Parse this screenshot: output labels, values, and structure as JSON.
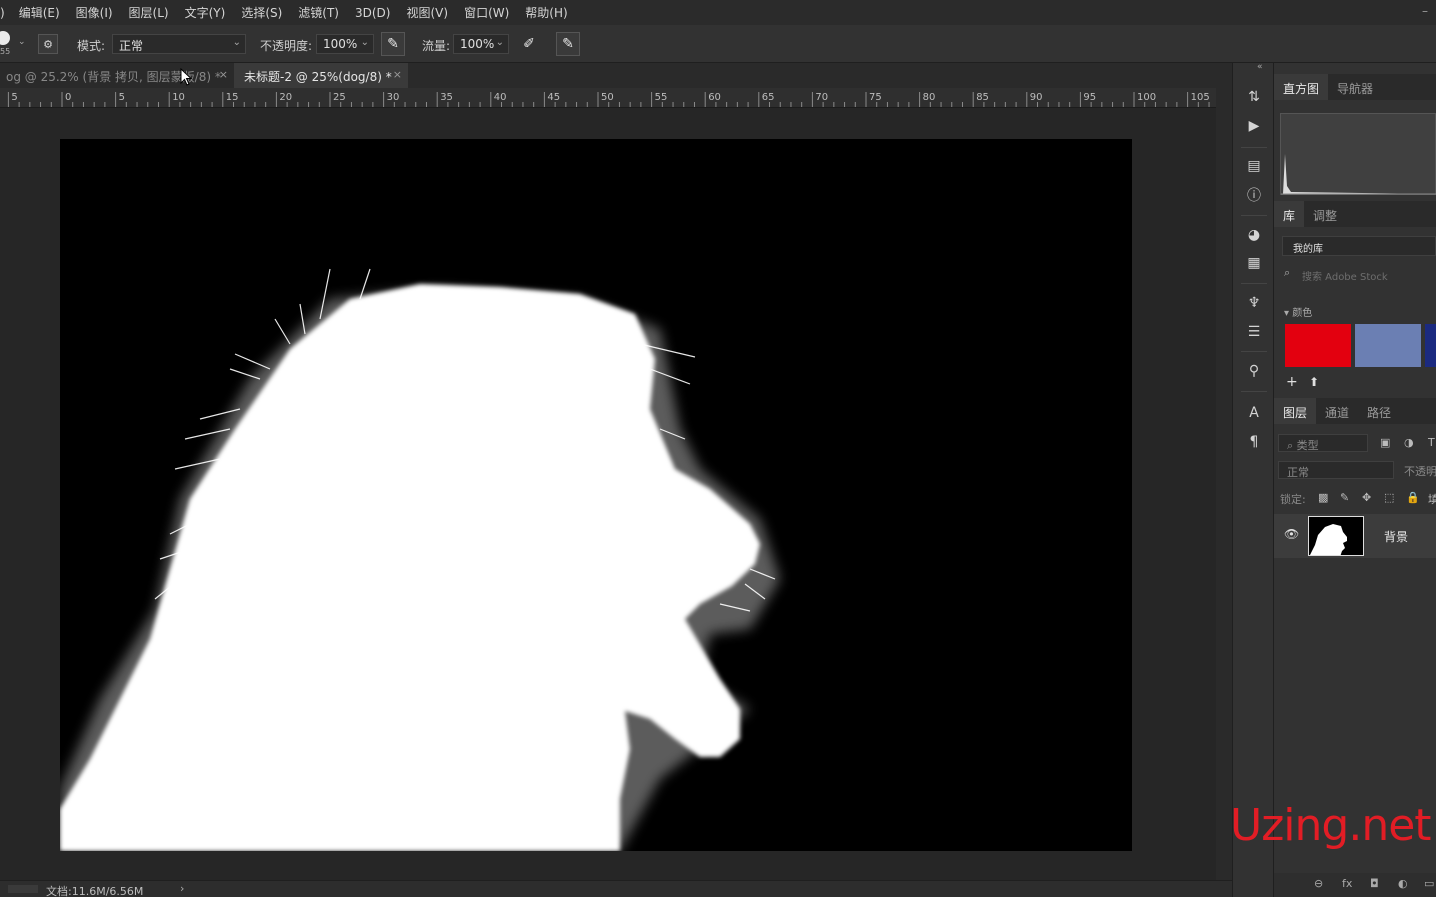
{
  "menu": {
    "partial_first": ")",
    "items": [
      "编辑(E)",
      "图像(I)",
      "图层(L)",
      "文字(Y)",
      "选择(S)",
      "滤镜(T)",
      "3D(D)",
      "视图(V)",
      "窗口(W)",
      "帮助(H)"
    ],
    "minimize": "–"
  },
  "options": {
    "brush_size": "55",
    "mode_label": "模式:",
    "mode_value": "正常",
    "opacity_label": "不透明度:",
    "opacity_value": "100%",
    "flow_label": "流量:",
    "flow_value": "100%"
  },
  "tabs": [
    {
      "label": "og @ 25.2% (背景 拷贝, 图层蒙版/8) *",
      "close": "×",
      "active": false
    },
    {
      "label": "未标题-2 @ 25%(dog/8) *",
      "close": "×",
      "active": true
    }
  ],
  "ruler": {
    "labels": [
      "5",
      "0",
      "5",
      "10",
      "15",
      "20",
      "25",
      "30",
      "35",
      "40",
      "45",
      "50",
      "55",
      "60",
      "65",
      "70",
      "75",
      "80",
      "85",
      "90",
      "95",
      "100",
      "105"
    ]
  },
  "status": {
    "doc_info": "文档:11.6M/6.56M",
    "arrow": "›"
  },
  "panels": {
    "histogram_tabs": [
      "直方图",
      "导航器"
    ],
    "library_tabs": [
      "库",
      "调整"
    ],
    "library_name": "我的库",
    "search_placeholder": "搜索 Adobe Stock",
    "colors_header": "▾ 颜色",
    "swatch_colors": [
      "#e3000f",
      "#6b7fb3",
      "#1b2a80"
    ],
    "layers_tabs": [
      "图层",
      "通道",
      "路径"
    ],
    "filter_label": "类型",
    "blend_value": "正常",
    "opacity_label": "不透明",
    "lock_label": "锁定:",
    "layer_name": "背景"
  },
  "watermark": "Uzing.net"
}
